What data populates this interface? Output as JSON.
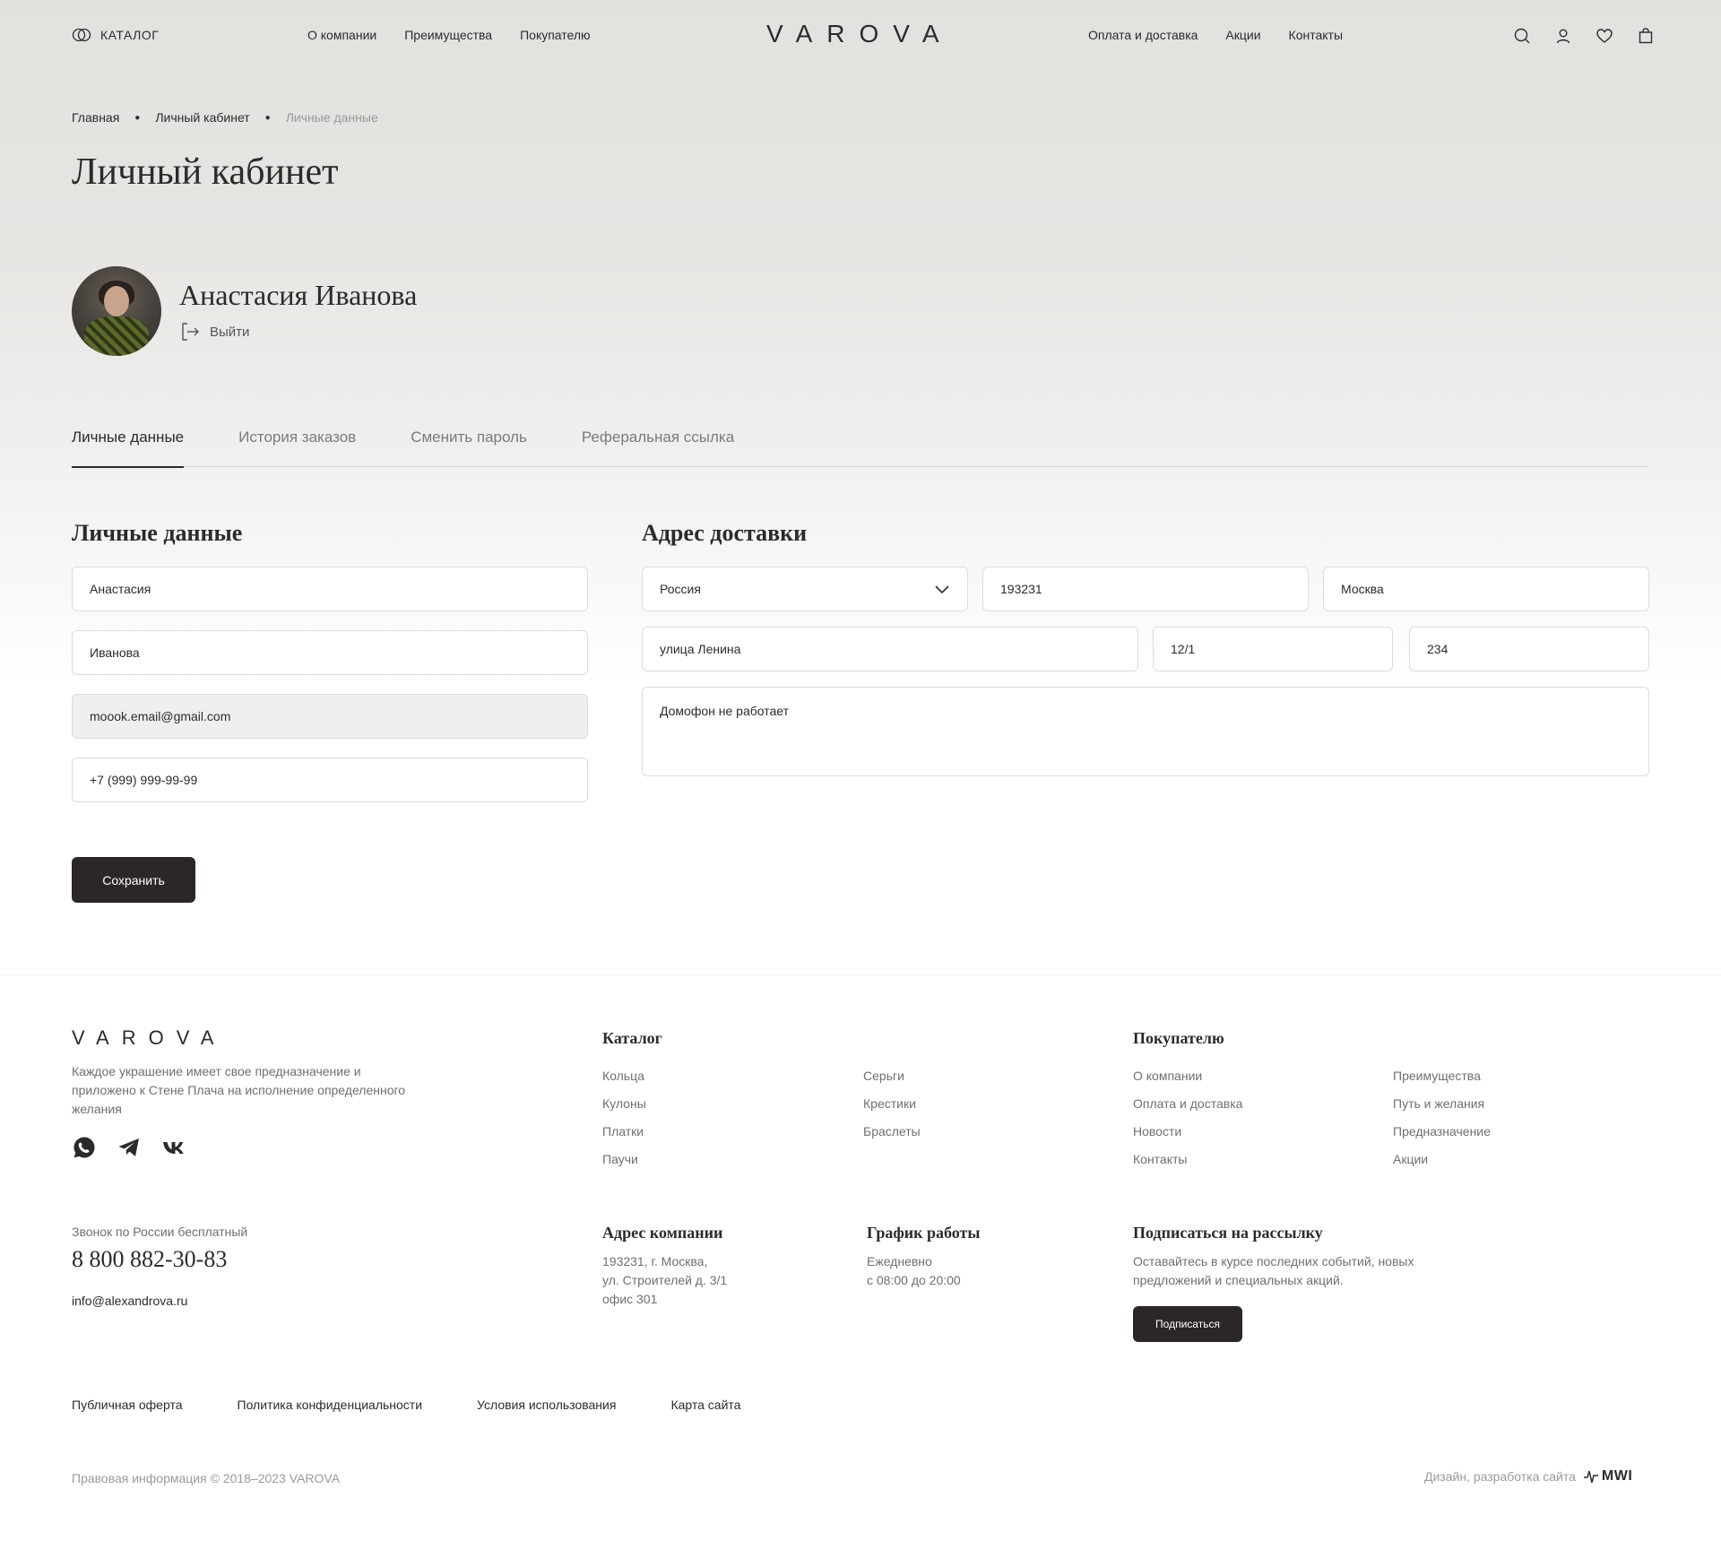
{
  "header": {
    "catalog_label": "КАТАЛОГ",
    "nav_left": [
      "О компании",
      "Преимущества",
      "Покупателю"
    ],
    "logo": "VAROVA",
    "nav_right": [
      "Оплата и доставка",
      "Акции",
      "Контакты"
    ],
    "icons": [
      "search-icon",
      "user-icon",
      "heart-icon",
      "bag-icon"
    ]
  },
  "breadcrumb": [
    "Главная",
    "Личный кабинет",
    "Личные данные"
  ],
  "page_title": "Личный кабинет",
  "profile": {
    "name": "Анастасия Иванова",
    "logout_label": "Выйти"
  },
  "tabs": [
    {
      "label": "Личные данные",
      "active": true
    },
    {
      "label": "История заказов",
      "active": false
    },
    {
      "label": "Сменить пароль",
      "active": false
    },
    {
      "label": "Реферальная ссылка",
      "active": false
    }
  ],
  "personal": {
    "title": "Личные данные",
    "first_name": "Анастасия",
    "last_name": "Иванова",
    "email": "moook.email@gmail.com",
    "phone": "+7 (999) 999-99-99",
    "save_label": "Сохранить"
  },
  "address": {
    "title": "Адрес доставки",
    "country": "Россия",
    "zip": "193231",
    "city": "Москва",
    "street": "улица Ленина",
    "house": "12/1",
    "apartment": "234",
    "comment": "Домофон не работает"
  },
  "footer": {
    "logo": "VAROVA",
    "description": "Каждое украшение имеет свое предназначение и приложено к Стене Плача на исполнение определенного желания",
    "social": [
      "whatsapp-icon",
      "telegram-icon",
      "vk-icon"
    ],
    "catalog_title": "Каталог",
    "catalog_col1": [
      "Кольца",
      "Кулоны",
      "Платки",
      "Паучи"
    ],
    "catalog_col2": [
      "Серьги",
      "Крестики",
      "Браслеты"
    ],
    "buyer_title": "Покупателю",
    "buyer_col1": [
      "О компании",
      "Оплата и доставка",
      "Новости",
      "Контакты"
    ],
    "buyer_col2": [
      "Преимущества",
      "Путь и желания",
      "Предназначение",
      "Акции"
    ],
    "call_note": "Звонок по России бесплатный",
    "phone": "8 800 882-30-83",
    "email": "info@alexandrova.ru",
    "address_title": "Адрес компании",
    "address_lines": [
      "193231, г. Москва,",
      "ул. Строителей д. 3/1",
      "офис 301"
    ],
    "schedule_title": "График работы",
    "schedule_lines": [
      "Ежедневно",
      "с 08:00 до 20:00"
    ],
    "subscribe_title": "Подписаться на рассылку",
    "subscribe_text": "Оставайтесь в курсе последних событий, новых предложений и специальных акций.",
    "subscribe_button": "Подписаться",
    "legal_links": [
      "Публичная оферта",
      "Политика конфиденциальности",
      "Условия использования",
      "Карта сайта"
    ],
    "copyright": "Правовая информация © 2018–2023 VAROVA",
    "developer_label": "Дизайн, разработка сайта",
    "developer_logo": "MWI"
  }
}
